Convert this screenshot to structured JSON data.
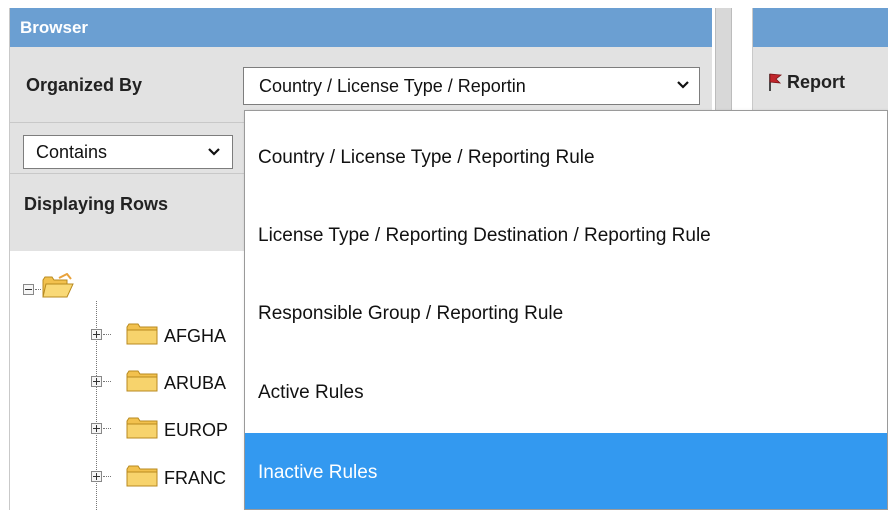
{
  "browser": {
    "title": "Browser",
    "organized_by_label": "Organized By",
    "organized_by_value": "Country / License Type / Reportin",
    "filter_value": "Contains",
    "displaying_rows_label": "Displaying Rows",
    "tree": {
      "root_icon": "open-folder-icon",
      "nodes": [
        {
          "label": "AFGHA"
        },
        {
          "label": "ARUBA"
        },
        {
          "label": "EUROP"
        },
        {
          "label": "FRANC"
        }
      ]
    }
  },
  "right_panel": {
    "column_label": "Report",
    "flag_icon": "flag-icon"
  },
  "dropdown": {
    "options": [
      {
        "label": "Country / License Type / Reporting Rule",
        "selected": false
      },
      {
        "label": "License Type / Reporting Destination / Reporting Rule",
        "selected": false
      },
      {
        "label": "Responsible Group / Reporting Rule",
        "selected": false
      },
      {
        "label": "Active Rules",
        "selected": false
      },
      {
        "label": "Inactive Rules",
        "selected": true
      }
    ]
  },
  "colors": {
    "header_blue": "#6b9fd2",
    "toolbar_gray": "#e2e2e2",
    "selection_blue": "#3399f0"
  }
}
